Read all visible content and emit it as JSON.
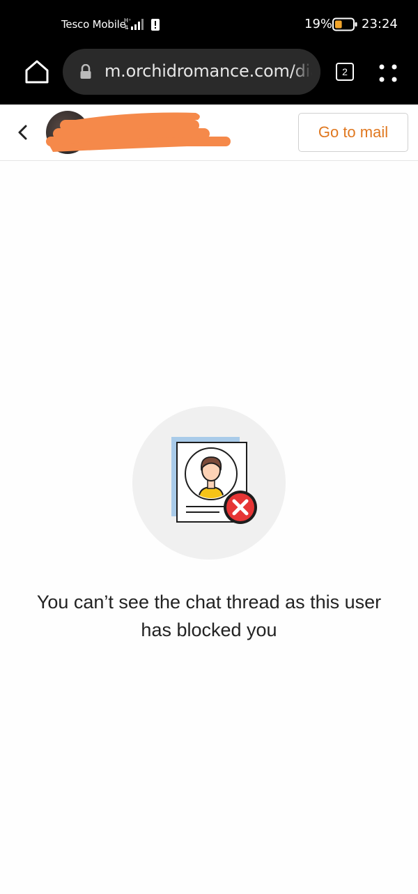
{
  "status_bar": {
    "carrier": "Tesco Mobile",
    "battery_percent": "19%",
    "battery_level": 0.19,
    "time": "23:24",
    "icons": [
      "signal-icon",
      "alert-icon",
      "battery-icon"
    ]
  },
  "browser": {
    "url": "m.orchidromance.com/dia",
    "tab_count": "2",
    "icons": [
      "home-icon",
      "lock-icon",
      "tabs-icon",
      "more-menu-icon"
    ]
  },
  "header": {
    "back_icon": "chevron-left-icon",
    "go_to_mail_label": "Go to mail",
    "accent_color": "#e07820"
  },
  "content": {
    "blocked_message": "You can’t see the chat thread as this user has blocked you",
    "illustration_icon": "blocked-user-illustration"
  }
}
